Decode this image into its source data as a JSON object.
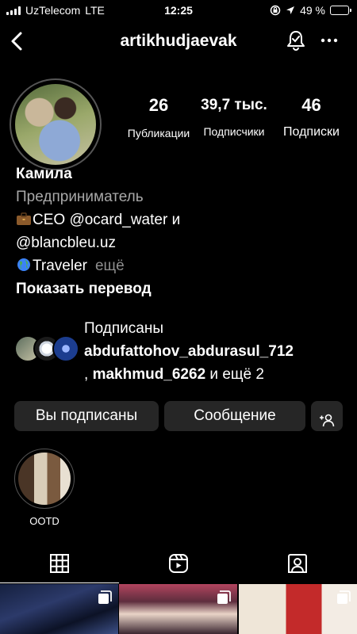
{
  "status_bar": {
    "carrier": "UzTelecom",
    "network": "LTE",
    "time": "12:25",
    "battery_percent": "49 %",
    "battery_level": 0.49,
    "battery_color": "#ffd60a"
  },
  "header": {
    "username": "artikhudjaevak",
    "back_icon": "chevron-left-icon",
    "notify_icon": "bell-check-icon",
    "more_icon": "more-horizontal-icon"
  },
  "stats": {
    "posts_count": "26",
    "posts_label": "Публикации",
    "followers_count": "39,7 тыс.",
    "followers_label": "Подписчики",
    "following_count": "46",
    "following_label": "Подписки"
  },
  "bio": {
    "name": "Камила",
    "category": "Предприниматель",
    "line1": "CEO @ocard_water и",
    "line2": "@blancbleu.uz",
    "line3": "Traveler",
    "more_label": "ещё",
    "translate_label": "Показать перевод"
  },
  "followed_by": {
    "prefix": "Подписаны",
    "user1": "abdufattohov_abdurasul_712",
    "separator": ",",
    "user2": "makhmud_6262",
    "suffix": "и ещё 2"
  },
  "buttons": {
    "following_label": "Вы подписаны",
    "message_label": "Сообщение",
    "add_user_icon": "add-user-icon"
  },
  "highlights": [
    {
      "label": "OOTD"
    }
  ],
  "tabs": [
    {
      "icon": "grid-icon",
      "active": true
    },
    {
      "icon": "reels-icon",
      "active": false
    },
    {
      "icon": "tagged-icon",
      "active": false
    }
  ],
  "posts": [
    {
      "type": "carousel"
    },
    {
      "type": "carousel"
    },
    {
      "type": "carousel"
    }
  ]
}
